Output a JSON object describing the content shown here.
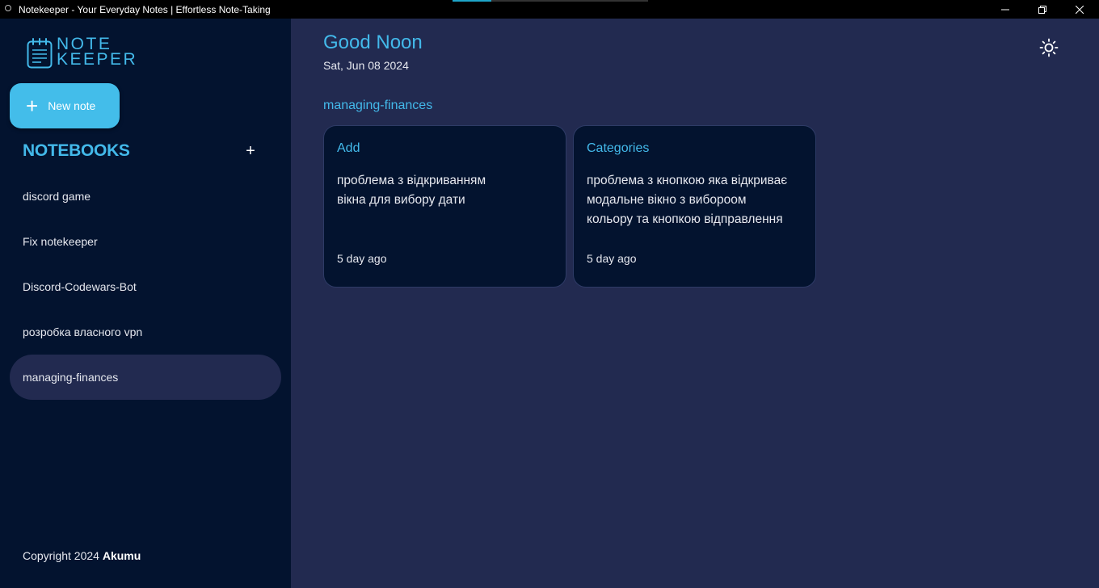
{
  "window": {
    "title": "Notekeeper - Your Everyday Notes | Effortless Note-Taking",
    "loading_progress": 0.2,
    "controls": {
      "minimize_icon": "minimize-icon",
      "maximize_icon": "restore-icon",
      "close_icon": "close-icon"
    }
  },
  "sidebar": {
    "logo": {
      "line1": "NOTE",
      "line2": "KEEPER",
      "icon": "notebook-icon"
    },
    "new_note": {
      "icon": "plus-icon",
      "label": "New note"
    },
    "notebooks_heading": "NOTEBOOKS",
    "add_notebook_icon": "plus-icon",
    "notebooks": [
      {
        "label": "discord game",
        "active": false
      },
      {
        "label": "Fix notekeeper",
        "active": false
      },
      {
        "label": "Discord-Codewars-Bot",
        "active": false
      },
      {
        "label": "розробка власного vpn",
        "active": false
      },
      {
        "label": "managing-finances",
        "active": true
      }
    ],
    "copyright": {
      "text": "Copyright 2024",
      "author": "Akumu"
    }
  },
  "main": {
    "greeting": "Good Noon",
    "date": "Sat, Jun 08 2024",
    "theme_toggle_icon": "sun-icon",
    "notebook_title": "managing-finances",
    "notes": [
      {
        "title": "Add",
        "body": [
          "проблема з відкриванням",
          "вікна для вибору дати"
        ],
        "time": "5 day ago"
      },
      {
        "title": "Categories",
        "body": [
          "проблема з кнопкою яка відкриває",
          "модальне вікно з вибороом",
          "кольору та кнопкою відправлення"
        ],
        "time": "5 day ago"
      }
    ]
  },
  "colors": {
    "accent": "#43b9ea",
    "sidebar_bg": "#03132f",
    "main_bg": "#222a50",
    "card_bg": "#03132f",
    "text": "#e6e8ef"
  }
}
